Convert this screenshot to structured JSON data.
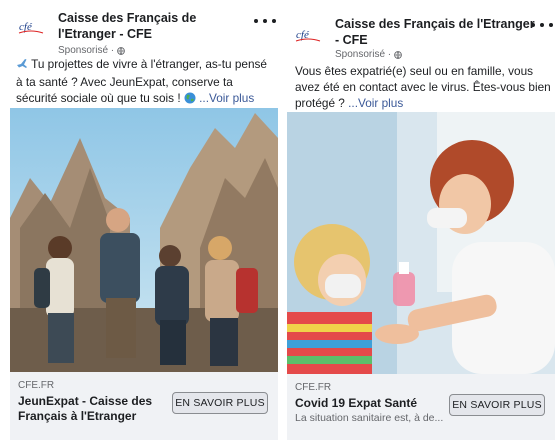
{
  "ads": [
    {
      "page_name": "Caisse des Français de l'Etranger - CFE",
      "sponsored": "Sponsorisé ·",
      "post_text": "Tu projettes de vivre à l'étranger, as-tu pensé à ta santé ? Avec JeunExpat, conserve ta sécurité sociale où que tu sois !",
      "see_more": "...Voir plus",
      "domain": "CFE.FR",
      "headline": "JeunExpat - Caisse des Français à l'Etranger",
      "subline": "",
      "cta": "EN SAVOIR PLUS"
    },
    {
      "page_name": "Caisse des Français de l'Etranger - CFE",
      "sponsored": "Sponsorisé ·",
      "post_text": "Vous êtes expatrié(e) seul ou en famille, vous avez été en contact avec le virus. Êtes-vous bien protégé ?",
      "see_more": "...Voir plus",
      "domain": "CFE.FR",
      "headline": "Covid 19 Expat Santé",
      "subline": "La situation sanitaire est, à de...",
      "cta": "EN SAVOIR PLUS"
    }
  ],
  "logo_text": "cfé",
  "colors": {
    "brand": "#3b5998",
    "footer_bg": "#f0f2f5",
    "muted": "#65676b"
  },
  "icons": [
    "cfe-logo",
    "globe-icon",
    "more-icon",
    "airplane-emoji",
    "earth-emoji"
  ]
}
